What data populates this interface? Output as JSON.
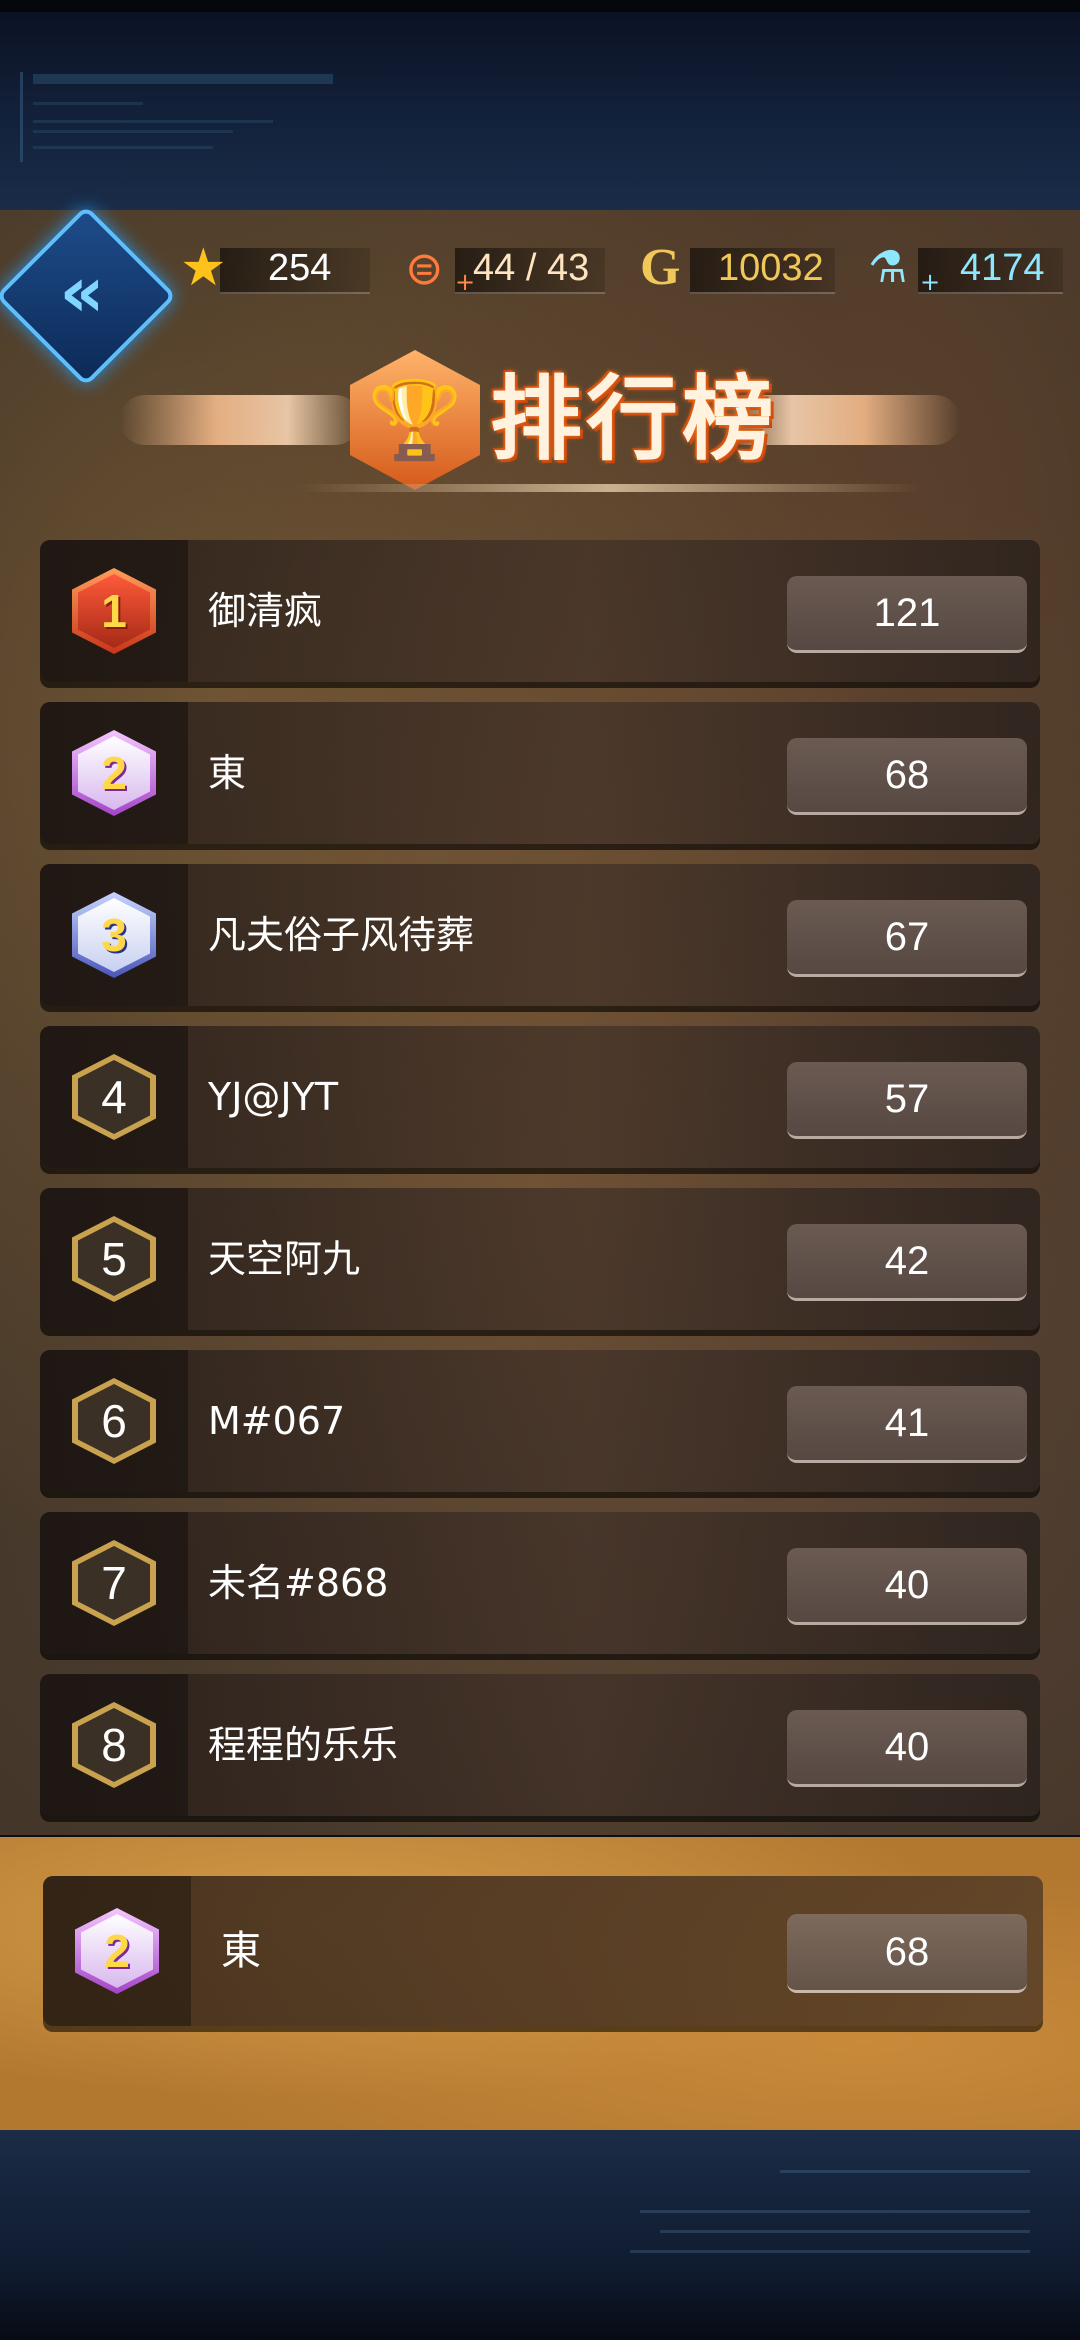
{
  "resources": {
    "stars": "254",
    "stamina": "44 / 43",
    "gold": "10032",
    "gems": "4174",
    "gold_symbol": "G",
    "plus": "+"
  },
  "header": {
    "title": "排行榜"
  },
  "leaderboard": [
    {
      "rank": "1",
      "name": "御清疯",
      "score": "121"
    },
    {
      "rank": "2",
      "name": "東",
      "score": "68"
    },
    {
      "rank": "3",
      "name": "凡夫俗子风待葬",
      "score": "67"
    },
    {
      "rank": "4",
      "name": "YJ@JYT",
      "score": "57"
    },
    {
      "rank": "5",
      "name": "天空阿九",
      "score": "42"
    },
    {
      "rank": "6",
      "name": "M#067",
      "score": "41"
    },
    {
      "rank": "7",
      "name": "未名#868",
      "score": "40"
    },
    {
      "rank": "8",
      "name": "程程的乐乐",
      "score": "40"
    }
  ],
  "self": {
    "rank": "2",
    "name": "東",
    "score": "68"
  },
  "colors": {
    "gold_rank": "#f5a623",
    "silver_rank": "#d9d9ef",
    "bronze_rank": "#9aa6ff",
    "hex_rank": "#c9a24f",
    "gold_text": "#f0c85a",
    "gem_text": "#8fe6ff"
  },
  "icons": {
    "back": "double-chevron-left-icon",
    "star": "star-icon",
    "stamina": "stamina-icon",
    "gold": "gold-coin-icon",
    "gem": "potion-icon",
    "trophy": "trophy-icon"
  }
}
